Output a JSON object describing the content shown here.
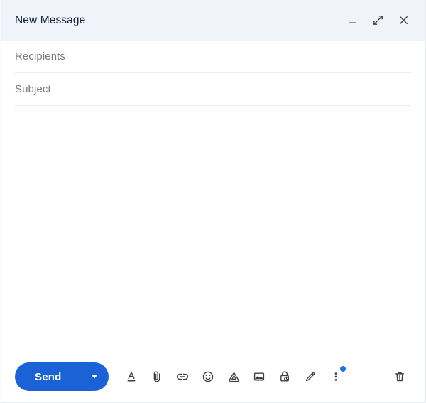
{
  "window": {
    "title": "New Message",
    "header_bg": "#f0f3fa",
    "accent_color": "#1a62d6",
    "badge_color": "#1a73e8",
    "controls": [
      {
        "name": "minimize",
        "label": "Minimize"
      },
      {
        "name": "expand",
        "label": "Full screen"
      },
      {
        "name": "close",
        "label": "Save & close"
      }
    ]
  },
  "fields": {
    "recipients": {
      "placeholder": "Recipients",
      "value": ""
    },
    "subject": {
      "placeholder": "Subject",
      "value": ""
    }
  },
  "body": {
    "value": "",
    "placeholder": ""
  },
  "toolbar": {
    "send_label": "Send",
    "send_caret_label": "More send options",
    "icons": [
      {
        "name": "formatting-options-icon",
        "label": "Formatting options"
      },
      {
        "name": "attach-file-icon",
        "label": "Attach files"
      },
      {
        "name": "insert-link-icon",
        "label": "Insert link"
      },
      {
        "name": "insert-emoji-icon",
        "label": "Insert emoji"
      },
      {
        "name": "insert-drive-icon",
        "label": "Insert files using Drive"
      },
      {
        "name": "insert-photo-icon",
        "label": "Insert photo"
      },
      {
        "name": "confidential-mode-icon",
        "label": "Toggle confidential mode"
      },
      {
        "name": "insert-signature-icon",
        "label": "Insert signature"
      },
      {
        "name": "more-options-icon",
        "label": "More options",
        "badge": true
      }
    ],
    "discard_label": "Discard draft"
  }
}
